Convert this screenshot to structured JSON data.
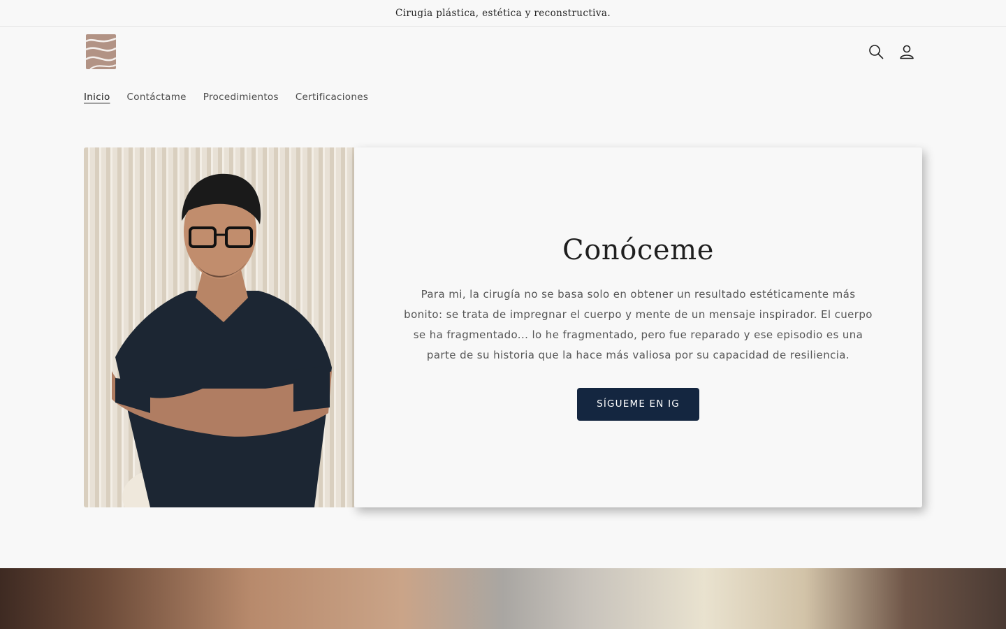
{
  "announcement": {
    "text": "Cirugia plástica, estética y reconstructiva."
  },
  "header": {
    "logo_icon": "logo-icon",
    "search_icon": "search-icon",
    "account_icon": "account-icon"
  },
  "nav": {
    "items": [
      {
        "label": "Inicio",
        "active": true
      },
      {
        "label": "Contáctame",
        "active": false
      },
      {
        "label": "Procedimientos",
        "active": false
      },
      {
        "label": "Certificaciones",
        "active": false
      }
    ]
  },
  "feature": {
    "photo_icon": "doctor-portrait-image",
    "title": "Conóceme",
    "body": "Para mi, la cirugía no se basa solo en obtener un resultado estéticamente más bonito: se trata de impregnar el cuerpo y mente de un mensaje inspirador. El cuerpo se ha fragmentado... lo he fragmentado, pero fue reparado y ese episodio es una parte de su historia que la hace más valiosa por su capacidad de resiliencia.",
    "cta_label": "SÍGUEME EN IG"
  },
  "colors": {
    "background": "#f8f8f8",
    "cta_background": "#142640",
    "logo": "#b29385"
  }
}
